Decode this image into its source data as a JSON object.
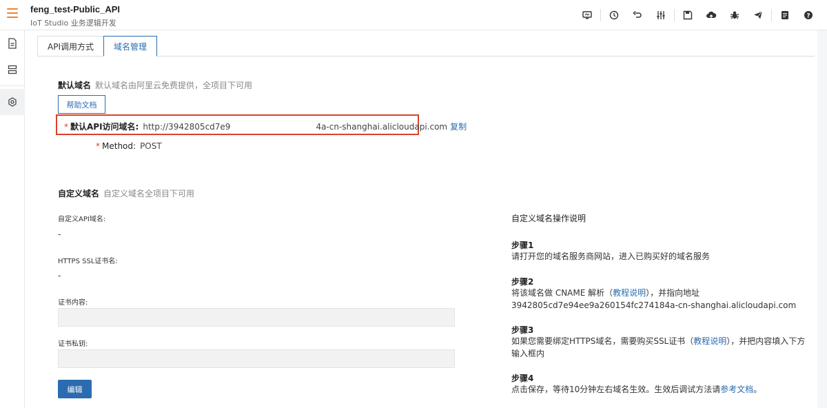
{
  "header": {
    "title": "feng_test-Public_API",
    "subtitle": "IoT Studio 业务逻辑开发"
  },
  "toolbar": {
    "icons": [
      "monitor-icon",
      "history-icon",
      "undo-icon",
      "settings-sliders-icon",
      "save-icon",
      "cloud-deploy-icon",
      "debug-icon",
      "publish-icon",
      "notes-icon",
      "help-icon"
    ]
  },
  "tabs": [
    {
      "label": "API调用方式",
      "active": false
    },
    {
      "label": "域名管理",
      "active": true
    }
  ],
  "default_domain": {
    "title": "默认域名",
    "desc": "默认域名由阿里云免费提供，全项目下可用",
    "help_button": "帮助文档",
    "api_label": "默认API访问域名:",
    "api_value_start": "http://3942805cd7e9",
    "api_value_end": "4a-cn-shanghai.alicloudapi.com",
    "copy_label": "复制",
    "method_label": "Method:",
    "method_value": "POST"
  },
  "custom_domain": {
    "title": "自定义域名",
    "desc": "自定义域名全项目下可用",
    "api_domain_label": "自定义API域名:",
    "api_domain_value": "-",
    "ssl_label": "HTTPS SSL证书名:",
    "ssl_value": "-",
    "cert_content_label": "证书内容:",
    "cert_key_label": "证书私钥:",
    "edit_button": "编辑"
  },
  "help_panel": {
    "title": "自定义域名操作说明",
    "step1_title": "步骤1",
    "step1_text": "请打开您的域名服务商网站，进入已购买好的域名服务",
    "step2_title": "步骤2",
    "step2_text_a": "将该域名做 CNAME 解析（",
    "step2_link": "教程说明",
    "step2_text_b": "），并指向地址",
    "step2_address": "3942805cd7e94ee9a260154fc274184a-cn-shanghai.alicloudapi.com",
    "step3_title": "步骤3",
    "step3_text_a": "如果您需要绑定HTTPS域名，需要购买SSL证书（",
    "step3_link": "教程说明",
    "step3_text_b": "），并把内容填入下方输入框内",
    "step4_title": "步骤4",
    "step4_text_a": "点击保存，等待10分钟左右域名生效。生效后调试方法请",
    "step4_link": "参考文档",
    "step4_text_b": "。"
  },
  "colors": {
    "accent": "#2b6cb0",
    "menu": "#f0812e",
    "highlight": "#d9412a"
  }
}
